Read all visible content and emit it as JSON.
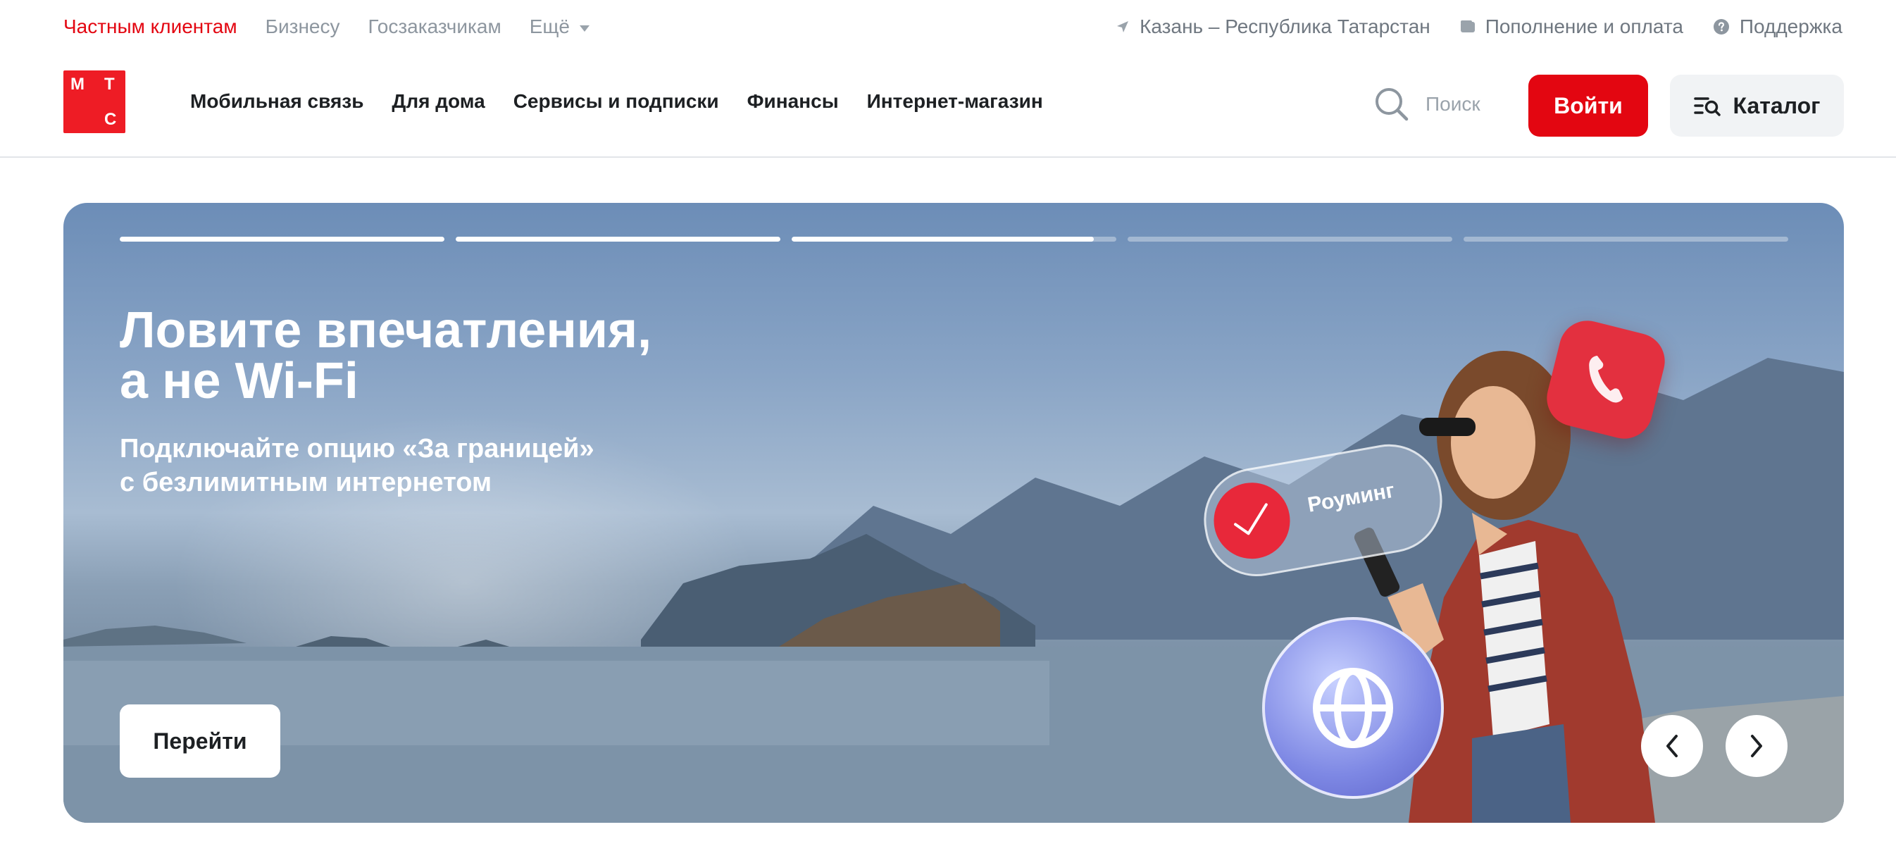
{
  "topbar": {
    "segments": [
      {
        "label": "Частным клиентам",
        "active": true
      },
      {
        "label": "Бизнесу",
        "active": false
      },
      {
        "label": "Госзаказчикам",
        "active": false
      },
      {
        "label": "Ещё",
        "active": false
      }
    ],
    "location": "Казань – Республика Татарстан",
    "payments": "Пополнение и оплата",
    "support": "Поддержка"
  },
  "header": {
    "logo_letters": [
      "М",
      "Т",
      "С"
    ],
    "nav": [
      "Мобильная связь",
      "Для дома",
      "Сервисы и подписки",
      "Финансы",
      "Интернет-магазин"
    ],
    "search_placeholder": "Поиск",
    "login": "Войти",
    "catalog": "Каталог"
  },
  "hero": {
    "slides_progress": [
      1,
      1,
      0.93,
      0,
      0
    ],
    "title_line1": "Ловите впечатления,",
    "title_line2": "а не Wi-Fi",
    "subtitle_line1": "Подключайте опцию «За границей»",
    "subtitle_line2": "с безлимитным интернетом",
    "cta": "Перейти",
    "badge_roaming": "Роуминг"
  },
  "colors": {
    "brand_red": "#e30611",
    "text_muted": "#8d969f"
  }
}
